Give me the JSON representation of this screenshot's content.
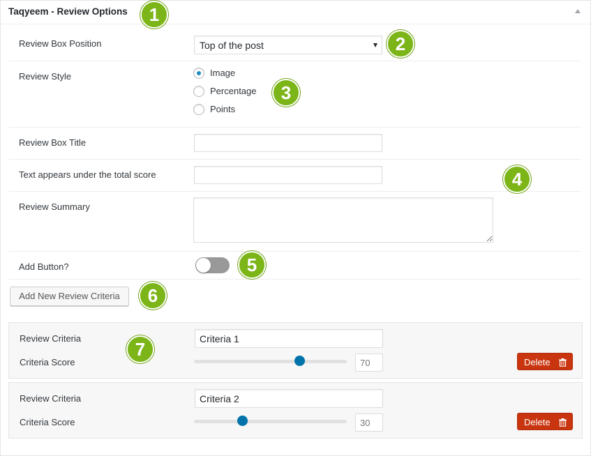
{
  "panel": {
    "title": "Taqyeem - Review Options"
  },
  "fields": {
    "position_label": "Review Box Position",
    "position_value": "Top of the post",
    "style_label": "Review Style",
    "style_options": [
      "Image",
      "Percentage",
      "Points"
    ],
    "style_selected": "Image",
    "box_title_label": "Review Box Title",
    "box_title_value": "",
    "under_score_label": "Text appears under the total score",
    "under_score_value": "",
    "summary_label": "Review Summary",
    "summary_value": "",
    "add_button_label": "Add Button?",
    "add_button_on": false
  },
  "add_criteria_button": "Add New Review Criteria",
  "criteria": [
    {
      "criteria_label": "Review Criteria",
      "name": "Criteria 1",
      "score_label": "Criteria Score",
      "score": "70",
      "delete_label": "Delete"
    },
    {
      "criteria_label": "Review Criteria",
      "name": "Criteria 2",
      "score_label": "Criteria Score",
      "score": "30",
      "delete_label": "Delete"
    }
  ],
  "callouts": [
    "1",
    "2",
    "3",
    "4",
    "5",
    "6",
    "7"
  ],
  "colors": {
    "callout": "#7cb518",
    "delete": "#c9350f",
    "slider_handle": "#0073aa",
    "radio_checked": "#1e8cbe",
    "toggle_off": "#999999"
  }
}
